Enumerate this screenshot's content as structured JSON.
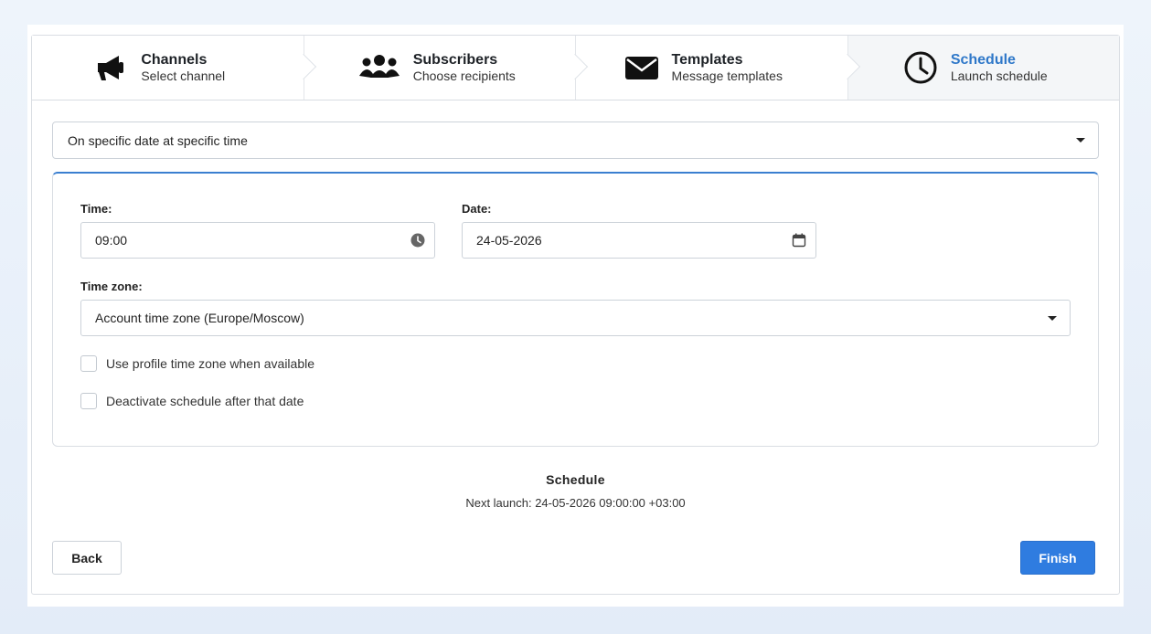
{
  "steps": [
    {
      "title": "Channels",
      "subtitle": "Select channel",
      "icon": "megaphone-icon"
    },
    {
      "title": "Subscribers",
      "subtitle": "Choose recipients",
      "icon": "users-icon"
    },
    {
      "title": "Templates",
      "subtitle": "Message templates",
      "icon": "envelope-icon"
    },
    {
      "title": "Schedule",
      "subtitle": "Launch schedule",
      "icon": "clock-icon",
      "active": true
    }
  ],
  "schedule_type": {
    "value": "On specific date at specific time"
  },
  "form": {
    "time_label": "Time:",
    "time_value": "09:00",
    "date_label": "Date:",
    "date_value": "24-05-2026",
    "timezone_label": "Time zone:",
    "timezone_value": "Account time zone (Europe/Moscow)",
    "use_profile_tz": {
      "label": "Use profile time zone when available",
      "checked": false
    },
    "deactivate_after": {
      "label": "Deactivate schedule after that date",
      "checked": false
    }
  },
  "summary": {
    "title": "Schedule",
    "next_launch": "Next launch: 24-05-2026 09:00:00 +03:00"
  },
  "buttons": {
    "back": "Back",
    "finish": "Finish"
  },
  "colors": {
    "accent": "#2f7ce0",
    "active_step_title": "#2f78c9",
    "panel_border_top": "#3a7fd0"
  }
}
